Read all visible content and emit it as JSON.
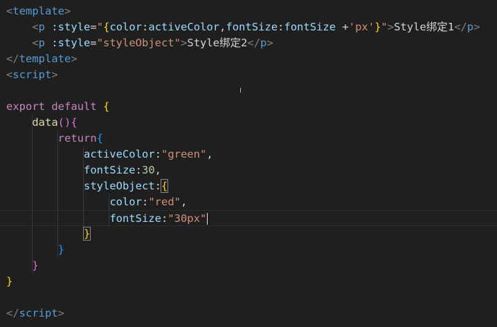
{
  "editor": {
    "lines": [
      {
        "tokens": [
          {
            "t": "<",
            "c": "tok-tag"
          },
          {
            "t": "template",
            "c": "tok-tagname"
          },
          {
            "t": ">",
            "c": "tok-tag"
          }
        ]
      },
      {
        "tokens": [
          {
            "t": "    ",
            "c": "tok-plain"
          },
          {
            "t": "<",
            "c": "tok-tag"
          },
          {
            "t": "p",
            "c": "tok-tagname"
          },
          {
            "t": " :style",
            "c": "tok-attr"
          },
          {
            "t": "=",
            "c": "tok-plain"
          },
          {
            "t": "\"",
            "c": "tok-str"
          },
          {
            "t": "{",
            "c": "b1"
          },
          {
            "t": "color",
            "c": "tok-prop"
          },
          {
            "t": ":",
            "c": "tok-plain"
          },
          {
            "t": "activeColor",
            "c": "tok-prop"
          },
          {
            "t": ",",
            "c": "tok-plain"
          },
          {
            "t": "fontSize",
            "c": "tok-prop"
          },
          {
            "t": ":",
            "c": "tok-plain"
          },
          {
            "t": "fontSize ",
            "c": "tok-prop"
          },
          {
            "t": "+",
            "c": "tok-plain"
          },
          {
            "t": "'px'",
            "c": "tok-str"
          },
          {
            "t": "}",
            "c": "b1"
          },
          {
            "t": "\"",
            "c": "tok-str"
          },
          {
            "t": ">",
            "c": "tok-tag"
          },
          {
            "t": "Style绑定1",
            "c": "tok-plain"
          },
          {
            "t": "</",
            "c": "tok-tag"
          },
          {
            "t": "p",
            "c": "tok-tagname"
          },
          {
            "t": ">",
            "c": "tok-tag"
          }
        ]
      },
      {
        "tokens": [
          {
            "t": "    ",
            "c": "tok-plain"
          },
          {
            "t": "<",
            "c": "tok-tag"
          },
          {
            "t": "p",
            "c": "tok-tagname"
          },
          {
            "t": " :style",
            "c": "tok-attr"
          },
          {
            "t": "=",
            "c": "tok-plain"
          },
          {
            "t": "\"styleObject\"",
            "c": "tok-str"
          },
          {
            "t": ">",
            "c": "tok-tag"
          },
          {
            "t": "Style绑定2",
            "c": "tok-plain"
          },
          {
            "t": "</",
            "c": "tok-tag"
          },
          {
            "t": "p",
            "c": "tok-tagname"
          },
          {
            "t": ">",
            "c": "tok-tag"
          }
        ]
      },
      {
        "tokens": [
          {
            "t": "</",
            "c": "tok-tag"
          },
          {
            "t": "template",
            "c": "tok-tagname"
          },
          {
            "t": ">",
            "c": "tok-tag"
          }
        ]
      },
      {
        "tokens": [
          {
            "t": "<",
            "c": "tok-tag"
          },
          {
            "t": "script",
            "c": "tok-tagname"
          },
          {
            "t": ">",
            "c": "tok-tag"
          }
        ]
      },
      {
        "tokens": []
      },
      {
        "tokens": [
          {
            "t": "export default ",
            "c": "tok-kw"
          },
          {
            "t": "{",
            "c": "b1"
          }
        ]
      },
      {
        "tokens": [
          {
            "t": "    ",
            "c": "tok-plain"
          },
          {
            "t": "data",
            "c": "tok-fn"
          },
          {
            "t": "()",
            "c": "b2"
          },
          {
            "t": "{",
            "c": "b2"
          }
        ]
      },
      {
        "tokens": [
          {
            "t": "        ",
            "c": "tok-plain"
          },
          {
            "t": "return",
            "c": "tok-kw"
          },
          {
            "t": "{",
            "c": "b3"
          }
        ]
      },
      {
        "tokens": [
          {
            "t": "            ",
            "c": "tok-plain"
          },
          {
            "t": "activeColor",
            "c": "tok-prop"
          },
          {
            "t": ":",
            "c": "tok-plain"
          },
          {
            "t": "\"green\"",
            "c": "tok-str"
          },
          {
            "t": ",",
            "c": "tok-plain"
          }
        ]
      },
      {
        "tokens": [
          {
            "t": "            ",
            "c": "tok-plain"
          },
          {
            "t": "fontSize",
            "c": "tok-prop"
          },
          {
            "t": ":",
            "c": "tok-plain"
          },
          {
            "t": "30",
            "c": "tok-num"
          },
          {
            "t": ",",
            "c": "tok-plain"
          }
        ]
      },
      {
        "tokens": [
          {
            "t": "            ",
            "c": "tok-plain"
          },
          {
            "t": "styleObject",
            "c": "tok-prop"
          },
          {
            "t": ":",
            "c": "tok-plain"
          },
          {
            "t": "{",
            "c": "b1",
            "match": true
          }
        ]
      },
      {
        "tokens": [
          {
            "t": "                ",
            "c": "tok-plain"
          },
          {
            "t": "color",
            "c": "tok-prop"
          },
          {
            "t": ":",
            "c": "tok-plain"
          },
          {
            "t": "\"red\"",
            "c": "tok-str"
          },
          {
            "t": ",",
            "c": "tok-plain"
          }
        ]
      },
      {
        "tokens": [
          {
            "t": "                ",
            "c": "tok-plain"
          },
          {
            "t": "fontSize",
            "c": "tok-prop"
          },
          {
            "t": ":",
            "c": "tok-plain"
          },
          {
            "t": "\"30px\"",
            "c": "tok-str"
          }
        ],
        "active": true,
        "cursor": true
      },
      {
        "tokens": [
          {
            "t": "            ",
            "c": "tok-plain"
          },
          {
            "t": "}",
            "c": "b1",
            "match": true
          }
        ]
      },
      {
        "tokens": [
          {
            "t": "        ",
            "c": "tok-plain"
          },
          {
            "t": "}",
            "c": "b3"
          }
        ]
      },
      {
        "tokens": [
          {
            "t": "    ",
            "c": "tok-plain"
          },
          {
            "t": "}",
            "c": "b2"
          }
        ]
      },
      {
        "tokens": [
          {
            "t": "}",
            "c": "b1"
          }
        ]
      },
      {
        "tokens": []
      },
      {
        "tokens": [
          {
            "t": "</",
            "c": "tok-tag"
          },
          {
            "t": "script",
            "c": "tok-tagname"
          },
          {
            "t": ">",
            "c": "tok-tag"
          }
        ]
      }
    ]
  },
  "colors": {
    "background": "#1f1f1f",
    "bracket_level1": "#ffd700",
    "bracket_level2": "#da70d6",
    "bracket_level3": "#179fff"
  },
  "mouse_cursor_icon": "text-ibeam-icon"
}
